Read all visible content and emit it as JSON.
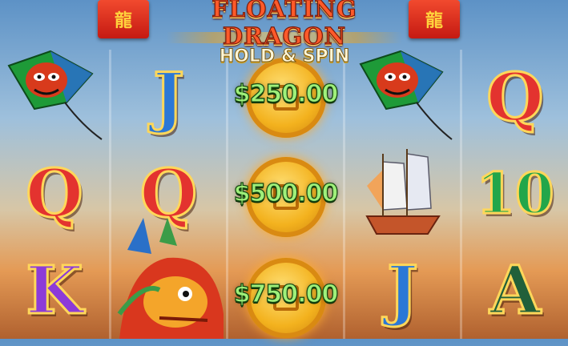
{
  "game": {
    "title_line1": "FLOATING DRAGON",
    "title_line2": "HOLD & SPIN",
    "lantern_glyph": "龍"
  },
  "colors": {
    "accent_gold": "#ffd75a",
    "prize_green": "#9ff07a",
    "lantern_red": "#d8231a"
  },
  "reels": [
    {
      "name": "reel-1",
      "symbols": [
        "kite",
        "Q",
        "K"
      ]
    },
    {
      "name": "reel-2",
      "symbols": [
        "J",
        "Q",
        "dragon"
      ]
    },
    {
      "name": "reel-3",
      "symbols": [
        "coin",
        "coin",
        "coin"
      ],
      "prizes": [
        "$250.00",
        "$500.00",
        "$750.00"
      ]
    },
    {
      "name": "reel-4",
      "symbols": [
        "kite",
        "ship",
        "J"
      ]
    },
    {
      "name": "reel-5",
      "symbols": [
        "Q",
        "10",
        "A"
      ]
    }
  ],
  "letters": {
    "reel1_q": "Q",
    "reel1_k": "K",
    "reel2_j": "J",
    "reel2_q": "Q",
    "reel4_j": "J",
    "reel5_q": "Q",
    "reel5_10": "10",
    "reel5_a": "A"
  }
}
